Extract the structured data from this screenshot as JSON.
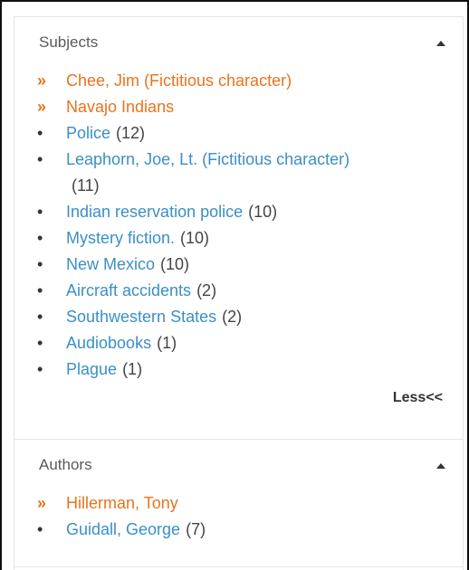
{
  "subjects": {
    "title": "Subjects",
    "items": [
      {
        "label": "Chee, Jim (Fictitious character)",
        "count": "",
        "selected": true
      },
      {
        "label": "Navajo Indians",
        "count": "",
        "selected": true
      },
      {
        "label": "Police",
        "count": "(12)",
        "selected": false
      },
      {
        "label": "Leaphorn, Joe, Lt. (Fictitious character)",
        "count": "(11)",
        "selected": false
      },
      {
        "label": "Indian reservation police",
        "count": "(10)",
        "selected": false
      },
      {
        "label": "Mystery fiction.",
        "count": "(10)",
        "selected": false
      },
      {
        "label": "New Mexico",
        "count": "(10)",
        "selected": false
      },
      {
        "label": "Aircraft accidents",
        "count": "(2)",
        "selected": false
      },
      {
        "label": "Southwestern States",
        "count": "(2)",
        "selected": false
      },
      {
        "label": "Audiobooks",
        "count": "(1)",
        "selected": false
      },
      {
        "label": "Plague",
        "count": "(1)",
        "selected": false
      }
    ],
    "less_label": "Less<<"
  },
  "authors": {
    "title": "Authors",
    "items": [
      {
        "label": "Hillerman, Tony",
        "count": "",
        "selected": true
      },
      {
        "label": "Guidall, George",
        "count": "(7)",
        "selected": false
      }
    ]
  },
  "markers": {
    "selected": "»",
    "unselected": "•"
  },
  "colors": {
    "selected": "#e8731f",
    "link": "#3a8fc6",
    "text": "#444444"
  }
}
